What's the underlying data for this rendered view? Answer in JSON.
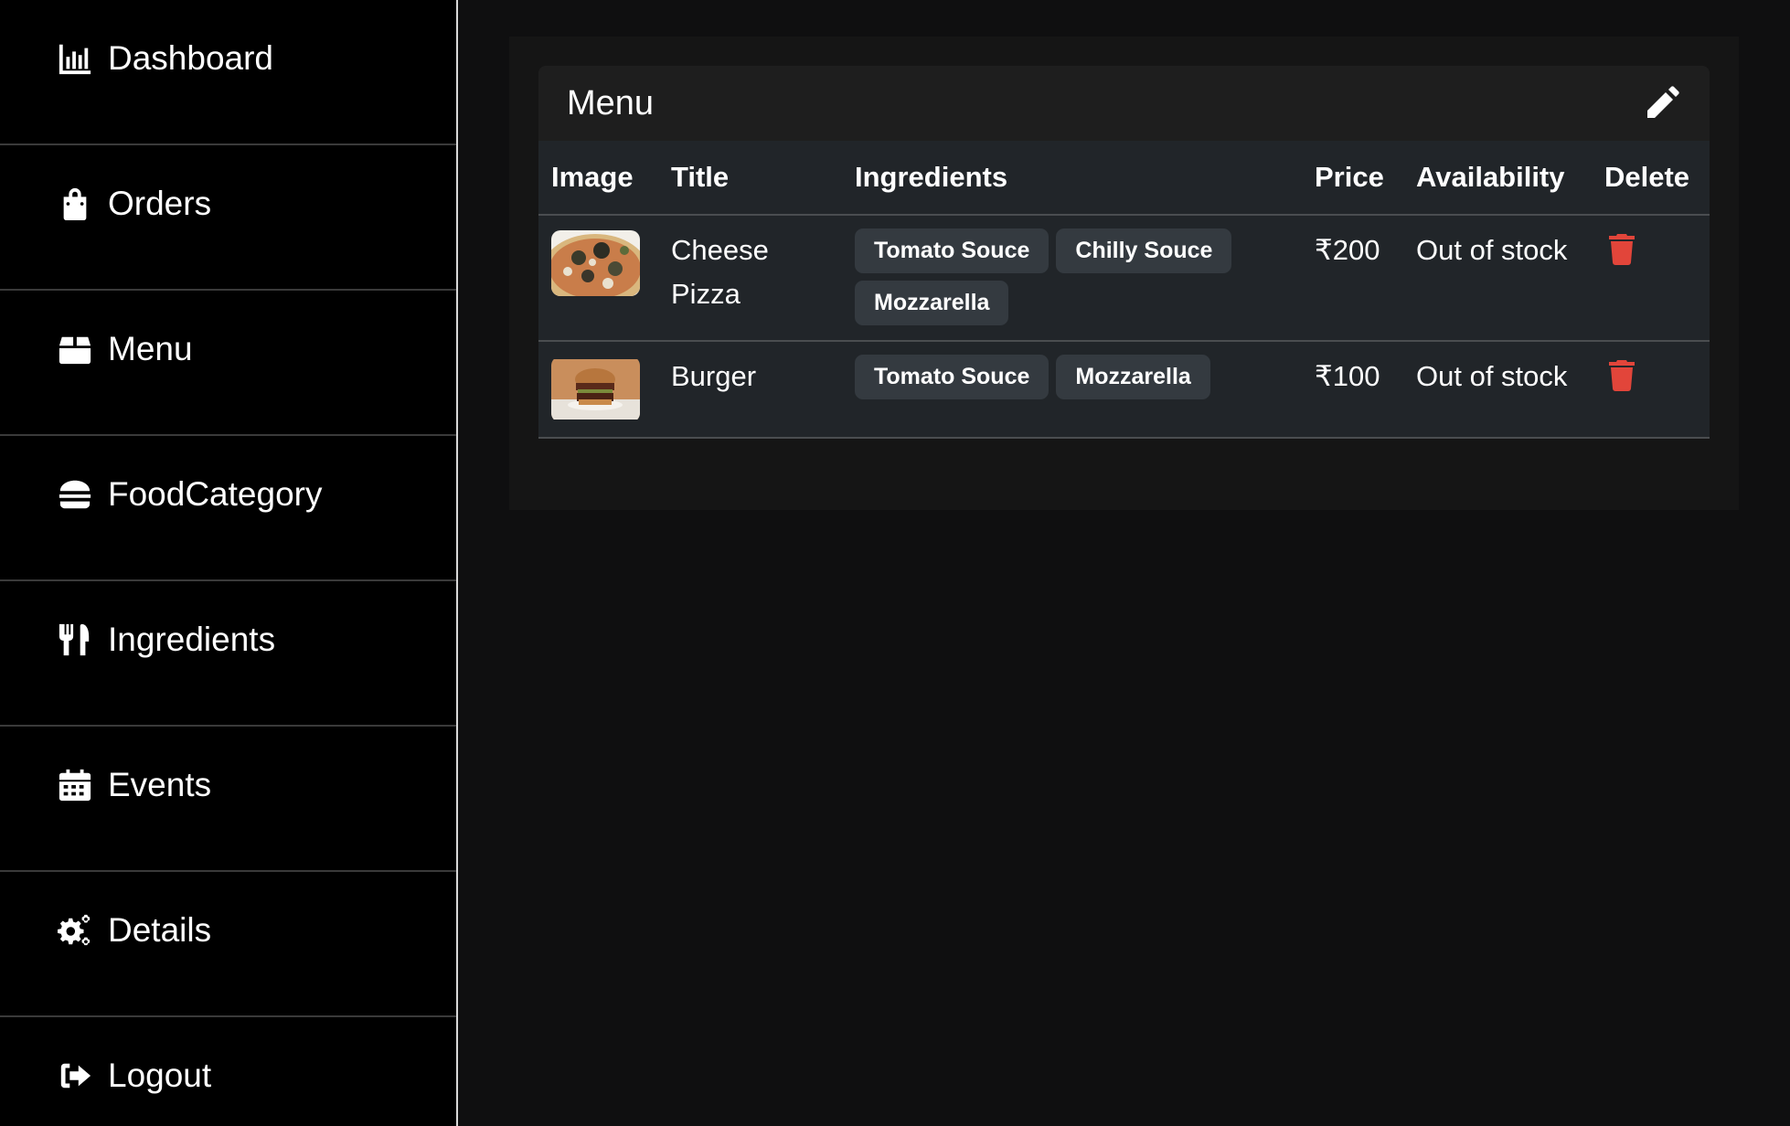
{
  "sidebar": {
    "items": [
      {
        "label": "Dashboard",
        "icon": "chart-bar-icon"
      },
      {
        "label": "Orders",
        "icon": "shopping-bag-icon"
      },
      {
        "label": "Menu",
        "icon": "box-icon"
      },
      {
        "label": "FoodCategory",
        "icon": "burger-icon"
      },
      {
        "label": "Ingredients",
        "icon": "utensils-icon"
      },
      {
        "label": "Events",
        "icon": "calendar-icon"
      },
      {
        "label": "Details",
        "icon": "gears-icon"
      },
      {
        "label": "Logout",
        "icon": "logout-icon"
      }
    ]
  },
  "card": {
    "title": "Menu",
    "edit_icon": "pencil-icon"
  },
  "table": {
    "headers": {
      "image": "Image",
      "title": "Title",
      "ingredients": "Ingredients",
      "price": "Price",
      "availability": "Availability",
      "delete": "Delete"
    },
    "rows": [
      {
        "image": "pizza-image",
        "title": "Cheese Pizza",
        "ingredients": [
          "Tomato Souce",
          "Chilly Souce",
          "Mozzarella"
        ],
        "price": "₹200",
        "availability": "Out of stock"
      },
      {
        "image": "burger-image",
        "title": "Burger",
        "ingredients": [
          "Tomato Souce",
          "Mozzarella"
        ],
        "price": "₹100",
        "availability": "Out of stock"
      }
    ]
  },
  "colors": {
    "sidebar_bg": "#000000",
    "page_bg": "#0f0f10",
    "table_bg": "#212529",
    "chip_bg": "#343a40",
    "delete": "#e2453a"
  }
}
